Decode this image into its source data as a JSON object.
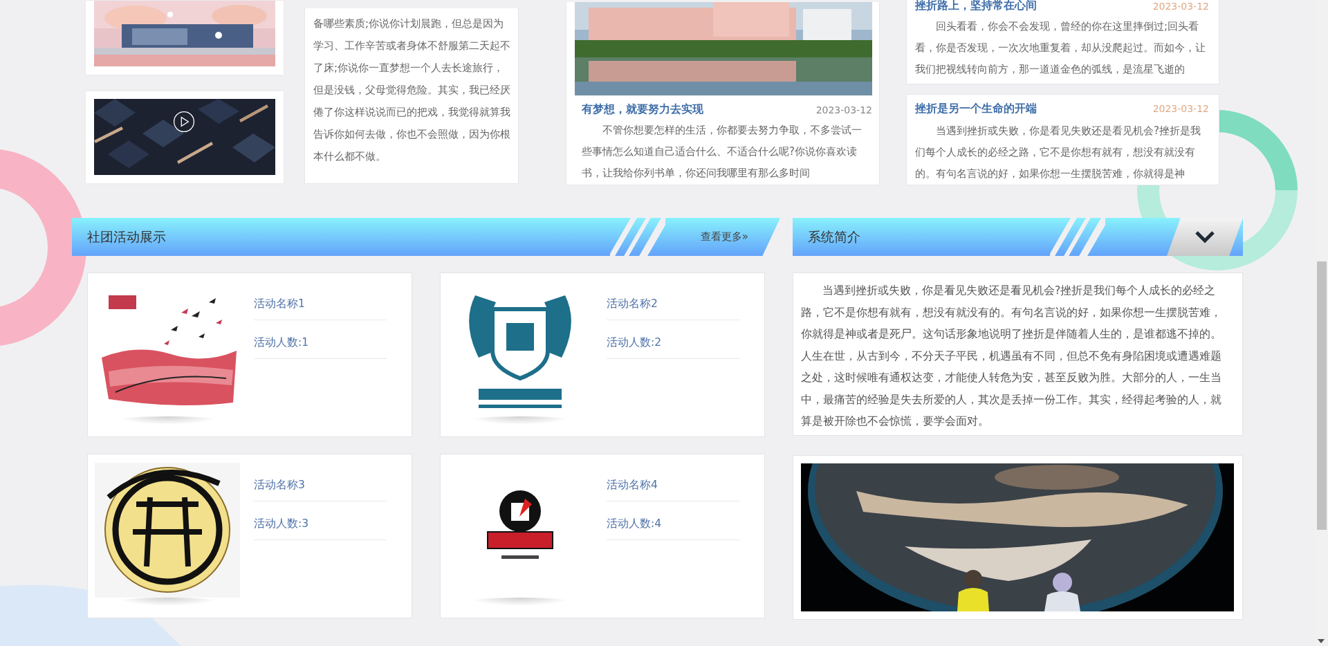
{
  "top_row": {
    "text_card": {
      "text": "备哪些素质;你说你计划晨跑，但总是因为学习、工作辛苦或者身体不舒服第二天起不了床;你说你一直梦想一个人去长途旅行，但是没钱，父母觉得危险。其实，我已经厌倦了你这样说说而已的把戏，我觉得就算我告诉你如何去做，你也不会照做，因为你根本什么都不做。"
    },
    "featured_article": {
      "title": "有梦想，就要努力去实现",
      "date": "2023-03-12",
      "excerpt": "不管你想要怎样的生活，你都要去努力争取，不多尝试一些事情怎么知道自己适合什么、不适合什么呢?你说你喜欢读书，让我给你列书单，你还问我哪里有那么多时间"
    },
    "articles": [
      {
        "title": "挫折路上，坚持常在心间",
        "date": "2023-03-12",
        "excerpt": "回头看看，你会不会发现，曾经的你在这里摔倒过;回头看看，你是否发现，一次次地重复着，却从没爬起过。而如今，让我们把视线转向前方，那一道道金色的弧线，是流星飞逝的"
      },
      {
        "title": "挫折是另一个生命的开端",
        "date": "2023-03-12",
        "excerpt": "当遇到挫折或失败，你是看见失败还是看见机会?挫折是我们每个人成长的必经之路，它不是你想有就有，想没有就没有的。有句名言说的好，如果你想一生摆脱苦难，你就得是神"
      }
    ]
  },
  "activities": {
    "title": "社团活动展示",
    "more_link": "查看更多»",
    "items": [
      {
        "name": "活动名称1",
        "members": "活动人数:1"
      },
      {
        "name": "活动名称2",
        "members": "活动人数:2"
      },
      {
        "name": "活动名称3",
        "members": "活动人数:3"
      },
      {
        "name": "活动名称4",
        "members": "活动人数:4"
      }
    ]
  },
  "intro": {
    "title": "系统简介",
    "text": "当遇到挫折或失败，你是看见失败还是看见机会?挫折是我们每个人成长的必经之路，它不是你想有就有，想没有就没有的。有句名言说的好，如果你想一生摆脱苦难，你就得是神或者是死尸。这句话形象地说明了挫折是伴随着人生的，是谁都逃不掉的。人生在世，从古到今，不分天子平民，机遇虽有不同，但总不免有身陷困境或遭遇难题之处，这时候唯有通权达变，才能使人转危为安，甚至反败为胜。大部分的人，一生当中，最痛苦的经验是失去所爱的人，其次是丢掉一份工作。其实，经得起考验的人，就算是被开除也不会惊慌，要学会面对。"
  }
}
